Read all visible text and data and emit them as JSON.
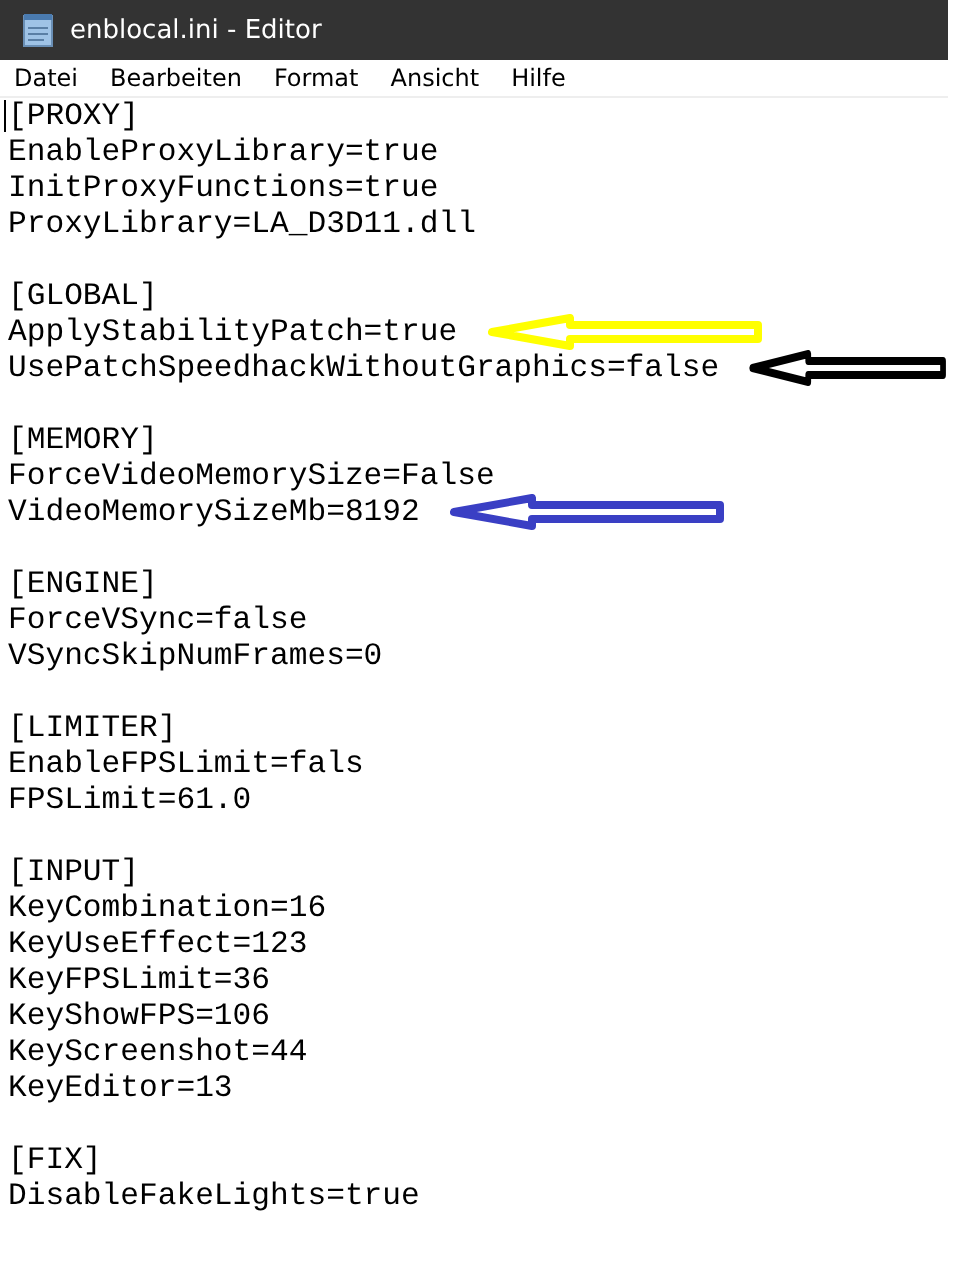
{
  "window": {
    "title": "enblocal.ini - Editor"
  },
  "menu": [
    "Datei",
    "Bearbeiten",
    "Format",
    "Ansicht",
    "Hilfe"
  ],
  "sections": [
    {
      "header": "[PROXY]",
      "lines": [
        {
          "text": "EnableProxyLibrary=true"
        },
        {
          "text": "InitProxyFunctions=true"
        },
        {
          "text": "ProxyLibrary=LA_D3D11.dll"
        }
      ]
    },
    {
      "header": "[GLOBAL]",
      "lines": [
        {
          "text": "ApplyStabilityPatch=true",
          "arrow": {
            "color": "#ffff00"
          }
        },
        {
          "text": "UsePatchSpeedhackWithoutGraphics=false",
          "arrow": {
            "color": "#000000"
          }
        }
      ]
    },
    {
      "header": "[MEMORY]",
      "lines": [
        {
          "text": "ForceVideoMemorySize=False"
        },
        {
          "text": "VideoMemorySizeMb=8192",
          "arrow": {
            "color": "#3a3fc4"
          }
        }
      ]
    },
    {
      "header": "[ENGINE]",
      "lines": [
        {
          "text": "ForceVSync=false"
        },
        {
          "text": "VSyncSkipNumFrames=0"
        }
      ]
    },
    {
      "header": "[LIMITER]",
      "lines": [
        {
          "text": "EnableFPSLimit=fals"
        },
        {
          "text": "FPSLimit=61.0"
        }
      ]
    },
    {
      "header": "[INPUT]",
      "lines": [
        {
          "text": "KeyCombination=16"
        },
        {
          "text": "KeyUseEffect=123"
        },
        {
          "text": "KeyFPSLimit=36"
        },
        {
          "text": "KeyShowFPS=106"
        },
        {
          "text": "KeyScreenshot=44"
        },
        {
          "text": "KeyEditor=13"
        }
      ]
    },
    {
      "header": "[FIX]",
      "lines": [
        {
          "text": "DisableFakeLights=true"
        }
      ]
    }
  ]
}
